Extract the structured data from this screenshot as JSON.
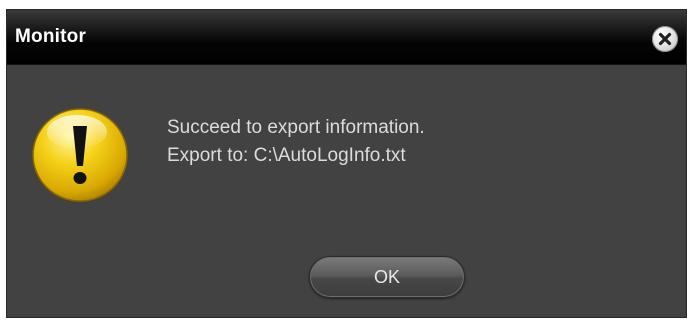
{
  "dialog": {
    "title": "Monitor",
    "message_lines": [
      "Succeed to export information.",
      "Export to: C:\\AutoLogInfo.txt"
    ],
    "ok_label": "OK",
    "close_icon": "close-icon",
    "status_icon": "warning-icon"
  },
  "colors": {
    "dialog_background": "#424242",
    "titlebar": "#000000",
    "icon_yellow": "#f2c400",
    "text": "#dcdcdc"
  }
}
